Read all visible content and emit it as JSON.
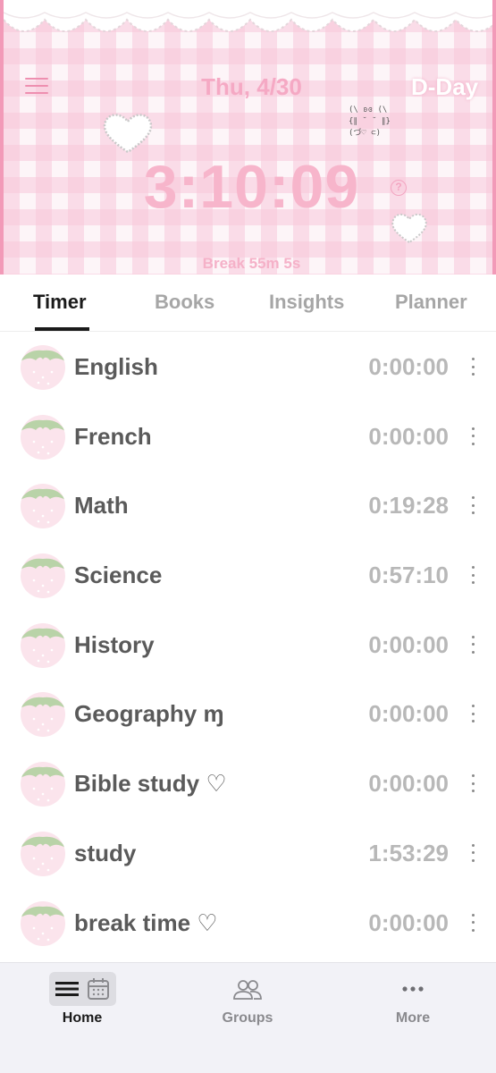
{
  "header": {
    "date": "Thu, 4/30",
    "dday": "D-Day",
    "kaomoji": "(\\ ʚɞ (\\\n{∥ ˘ ˘ ∥}\n(づ♡ ⊂)",
    "timer": "3:10:09",
    "help": "?",
    "break_text": "Break 55m 5s"
  },
  "tabs": [
    {
      "label": "Timer",
      "active": true
    },
    {
      "label": "Books",
      "active": false
    },
    {
      "label": "Insights",
      "active": false
    },
    {
      "label": "Planner",
      "active": false
    }
  ],
  "subjects": [
    {
      "name": "English",
      "time": "0:00:00"
    },
    {
      "name": "French",
      "time": "0:00:00"
    },
    {
      "name": "Math",
      "time": "0:19:28"
    },
    {
      "name": "Science",
      "time": "0:57:10"
    },
    {
      "name": "History",
      "time": "0:00:00"
    },
    {
      "name": "Geography ɱ",
      "time": "0:00:00"
    },
    {
      "name": "Bible study ♡",
      "time": "0:00:00"
    },
    {
      "name": "study",
      "time": "1:53:29"
    },
    {
      "name": "break time ♡",
      "time": "0:00:00"
    }
  ],
  "nav": {
    "home": "Home",
    "groups": "Groups",
    "more": "More"
  },
  "colors": {
    "accent_pink": "#f29ab8",
    "timer_pink": "#f7b5cb",
    "strawberry": "#fbe4ec",
    "leaf": "#b9d3a8"
  },
  "icons": [
    "menu-icon",
    "heart-icon",
    "help-icon",
    "strawberry-icon",
    "more-dots-icon",
    "list-view-icon",
    "calendar-icon",
    "groups-icon",
    "more-icon"
  ]
}
